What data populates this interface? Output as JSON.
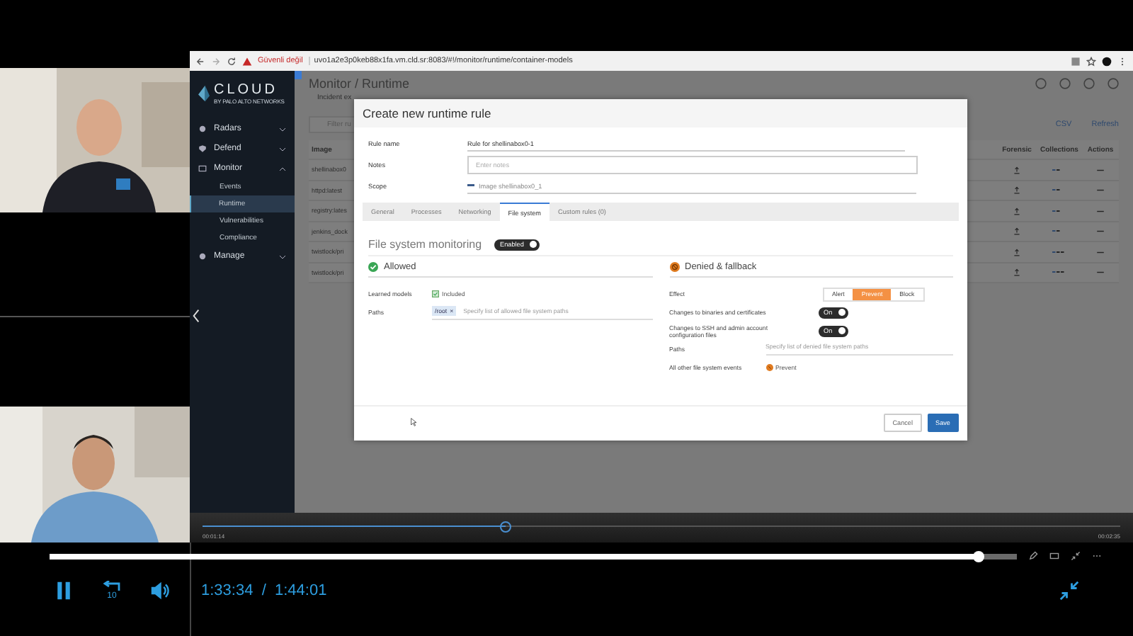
{
  "browser": {
    "security": "Güvenli değil",
    "url": "uvo1a2e3p0keb88x1fa.vm.cld.sr:8083/#!/monitor/runtime/container-models"
  },
  "app": {
    "logo": "CLOUD",
    "logo_sub": "BY PALO ALTO NETWORKS",
    "nav": [
      {
        "label": "Radars",
        "expanded": false
      },
      {
        "label": "Defend",
        "expanded": false
      },
      {
        "label": "Monitor",
        "expanded": true,
        "children": [
          {
            "label": "Events",
            "selected": false
          },
          {
            "label": "Runtime",
            "selected": true
          },
          {
            "label": "Vulnerabilities",
            "selected": false
          },
          {
            "label": "Compliance",
            "selected": false
          }
        ]
      },
      {
        "label": "Manage",
        "expanded": false
      }
    ],
    "page_title": "Monitor / Runtime",
    "subtab": "Incident ex",
    "filter_placeholder": "Filter ru",
    "actions": [
      "CSV",
      "Refresh"
    ],
    "table": {
      "columns": [
        "Image",
        "Forensic",
        "Collections",
        "Actions"
      ],
      "rows": [
        {
          "image": "shellinabox0"
        },
        {
          "image": "httpd:latest"
        },
        {
          "image": "registry:lates"
        },
        {
          "image": "jenkins_dock"
        },
        {
          "image": "twistlock/pri"
        },
        {
          "image": "twistlock/pri"
        }
      ]
    }
  },
  "modal": {
    "title": "Create new runtime rule",
    "fields": [
      {
        "label": "Rule name",
        "kind": "text",
        "value": "Rule for shellinabox0-1"
      },
      {
        "label": "Notes",
        "kind": "textarea",
        "placeholder": "Enter notes"
      },
      {
        "label": "Scope",
        "kind": "scope",
        "value": "Image shellinabox0_1"
      }
    ],
    "tabs": [
      {
        "label": "General",
        "selected": false
      },
      {
        "label": "Processes",
        "selected": false
      },
      {
        "label": "Networking",
        "selected": false
      },
      {
        "label": "File system",
        "selected": true
      },
      {
        "label": "Custom rules (0)",
        "selected": false
      }
    ],
    "section_title": "File system monitoring",
    "section_toggle": {
      "label": "Enabled",
      "on": true
    },
    "allowed": {
      "title": "Allowed",
      "learned_label": "Learned models",
      "learned": {
        "label": "Included",
        "checked": true
      },
      "paths_label": "Paths",
      "tags": [
        "/root"
      ],
      "tag_remove": "×",
      "paths_placeholder": "Specify list of allowed file system paths"
    },
    "denied": {
      "title": "Denied & fallback",
      "effect_label": "Effect",
      "effects": [
        {
          "label": "Alert",
          "selected": false
        },
        {
          "label": "Prevent",
          "selected": true
        },
        {
          "label": "Block",
          "selected": false
        }
      ],
      "switches": [
        {
          "label": "Changes to binaries and certificates",
          "text": "On",
          "on": true
        },
        {
          "label": "Changes to SSH and admin account configuration files",
          "text": "On",
          "on": true
        }
      ],
      "paths_label": "Paths",
      "paths_placeholder": "Specify list of denied file system paths",
      "other_label": "All other file system events",
      "other_value": "Prevent"
    },
    "buttons": [
      "Cancel",
      "Save"
    ]
  },
  "inner_player": {
    "elapsed": "00:01:14",
    "total": "00:02:35",
    "level": 0.33
  },
  "player": {
    "level": 0.96,
    "playing": true,
    "skip": "10",
    "elapsed": "1:33:34",
    "separator": "/",
    "total": "1:44:01"
  }
}
